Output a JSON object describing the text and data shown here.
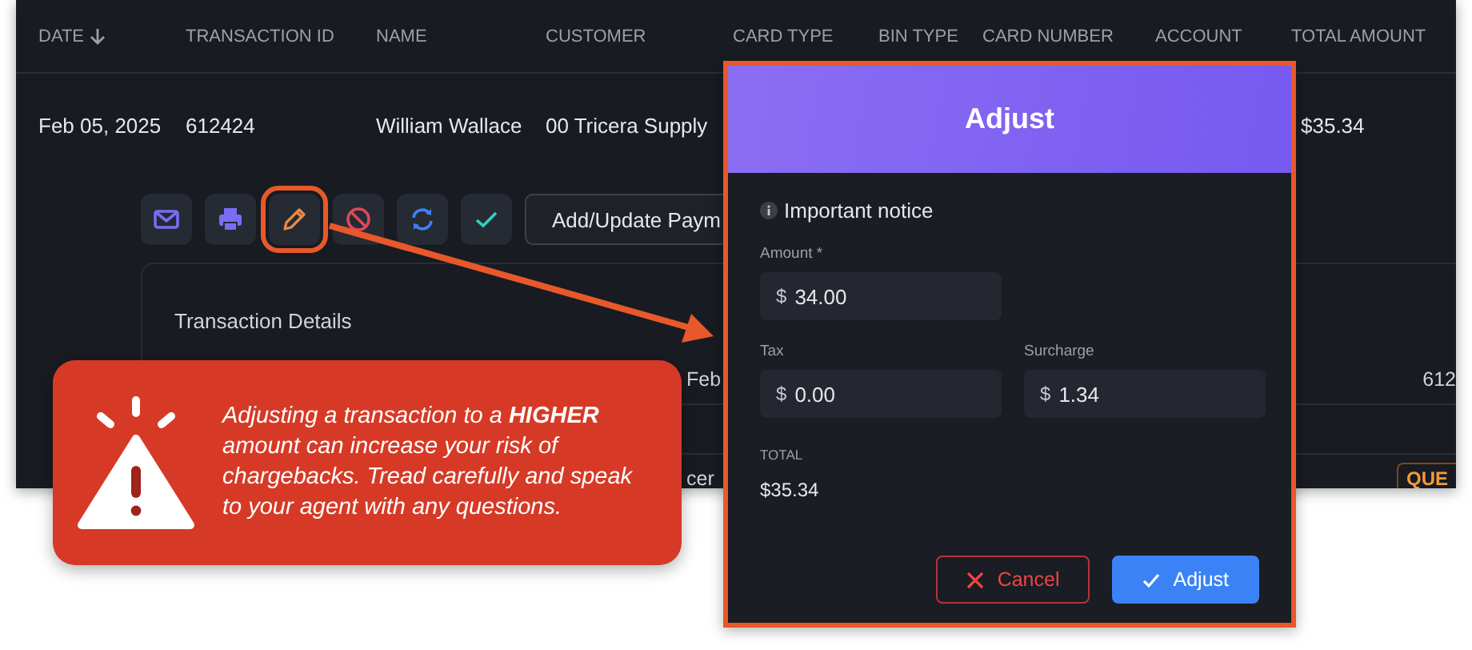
{
  "table": {
    "columns": [
      {
        "label": "DATE",
        "sorted": true
      },
      {
        "label": "TRANSACTION ID",
        "sorted": false
      },
      {
        "label": "NAME",
        "sorted": false
      },
      {
        "label": "CUSTOMER",
        "sorted": false
      },
      {
        "label": "CARD TYPE",
        "sorted": false
      },
      {
        "label": "BIN TYPE",
        "sorted": false
      },
      {
        "label": "CARD NUMBER",
        "sorted": false
      },
      {
        "label": "ACCOUNT",
        "sorted": false
      },
      {
        "label": "TOTAL AMOUNT",
        "sorted": false
      }
    ],
    "row": {
      "date": "Feb 05, 2025",
      "transaction_id": "612424",
      "name": "William Wallace",
      "customer": "00 Tricera Supply",
      "total_amount": "$35.34"
    }
  },
  "row_actions": [
    {
      "kind": "mail",
      "highlighted": false
    },
    {
      "kind": "print",
      "highlighted": false
    },
    {
      "kind": "edit",
      "highlighted": true
    },
    {
      "kind": "void",
      "highlighted": false
    },
    {
      "kind": "refund",
      "highlighted": false
    },
    {
      "kind": "approve",
      "highlighted": false
    }
  ],
  "add_payment_button": "Add/Update Paym",
  "details": {
    "title": "Transaction Details",
    "rows": [
      {
        "column_1": "Feb",
        "column_2": "612"
      },
      {
        "column_1": "cer",
        "status": "QUE"
      }
    ]
  },
  "modal": {
    "title": "Adjust",
    "notice": "Important notice",
    "field_rows": [
      [
        {
          "label": "Amount *",
          "prefix": "$",
          "value": "34.00"
        }
      ],
      [
        {
          "label": "Tax",
          "prefix": "$",
          "value": "0.00"
        },
        {
          "label": "Surcharge",
          "prefix": "$",
          "value": "1.34"
        }
      ]
    ],
    "total": {
      "label": "TOTAL",
      "value": "$35.34"
    },
    "buttons": [
      {
        "label": "Cancel",
        "kind": "cancel"
      },
      {
        "label": "Adjust",
        "kind": "confirm"
      }
    ]
  },
  "callout": {
    "text": "Adjusting a transaction to a **HIGHER** amount can increase your risk of chargebacks. Tread carefully and speak to your agent with any questions."
  }
}
